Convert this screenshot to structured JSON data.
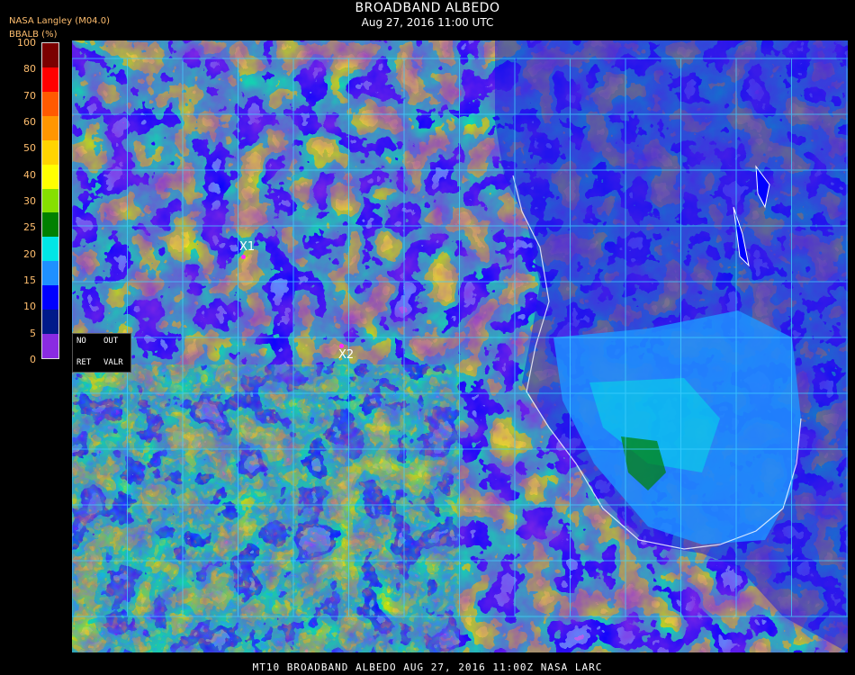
{
  "header": {
    "title": "BROADBAND ALBEDO",
    "subtitle": "Aug 27, 2016 11:00 UTC",
    "producer": "NASA Langley (M04.0)"
  },
  "colorbar": {
    "title": "BBALB (%)",
    "ticks": [
      "100",
      "80",
      "70",
      "60",
      "50",
      "40",
      "30",
      "25",
      "20",
      "15",
      "10",
      "5",
      "0"
    ],
    "colors": [
      "#7b0000",
      "#ff0000",
      "#ff5a00",
      "#ff9600",
      "#ffd400",
      "#ffff00",
      "#86e000",
      "#008000",
      "#00e6e6",
      "#1e90ff",
      "#0000ff",
      "#001a8a",
      "#8a2be2"
    ]
  },
  "legend": {
    "no": "NO",
    "out": "OUT",
    "ret": "RET",
    "valr": "VALR"
  },
  "markers": [
    {
      "label": "X1",
      "color": "#ff29ff"
    },
    {
      "label": "X2",
      "color": "#ff29ff"
    }
  ],
  "footer": "MT10  BROADBAND ALBEDO   AUG 27, 2016 11:00Z   NASA LARC",
  "grid": {
    "line_color": "#40d0ff"
  }
}
